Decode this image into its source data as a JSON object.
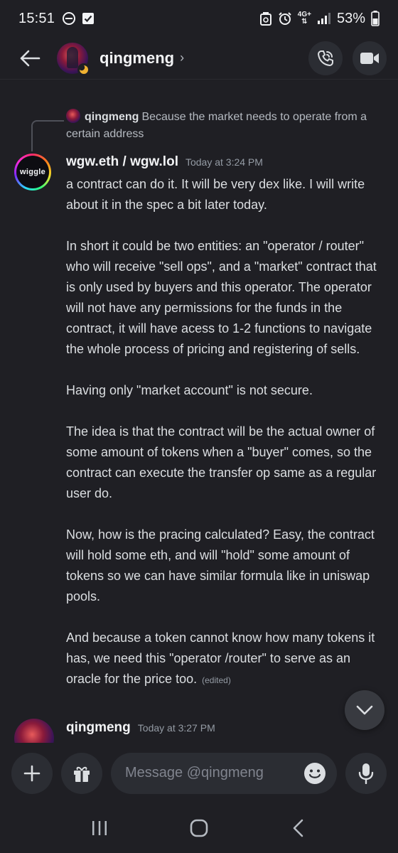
{
  "status_bar": {
    "time": "15:51",
    "network": "4G+",
    "battery": "53%"
  },
  "header": {
    "name": "qingmeng",
    "chevron": "›"
  },
  "reply": {
    "author": "qingmeng",
    "text": "Because the market needs to operate from a certain address"
  },
  "message1": {
    "avatar_text": "wiggle",
    "author": "wgw.eth / wgw.lol",
    "timestamp": "Today at 3:24 PM",
    "paragraphs": [
      "a contract can do it. It will be very dex like. I will write about it in the spec a bit later today.",
      "In short it could be two entities: an \"operator / router\" who will receive \"sell ops\", and a \"market\" contract that is only used by buyers and this operator. The operator will not have any permissions for the funds in the contract, it will have acess to 1-2 functions to navigate the whole process of pricing and registering of sells.",
      "Having only \"market account\" is not secure.",
      "The idea is that the contract will be the actual owner of some amount of tokens when a \"buyer\" comes, so the contract can execute the transfer op same as a regular user do.",
      "Now, how is the pracing calculated? Easy, the contract will hold some eth, and will \"hold\" some amount of tokens so we can have similar formula like in uniswap pools.",
      "And because a token cannot know how many tokens it has, we need this \"operator /router\" to serve as an oracle for the price too."
    ],
    "edited": "(edited)"
  },
  "message2": {
    "author": "qingmeng",
    "timestamp": "Today at 3:27 PM"
  },
  "composer": {
    "placeholder": "Message @qingmeng"
  },
  "colors": {
    "background": "#1f1f24",
    "button": "#2b2d33",
    "text_primary": "#f2f3f5",
    "text_muted": "#949ba4"
  }
}
